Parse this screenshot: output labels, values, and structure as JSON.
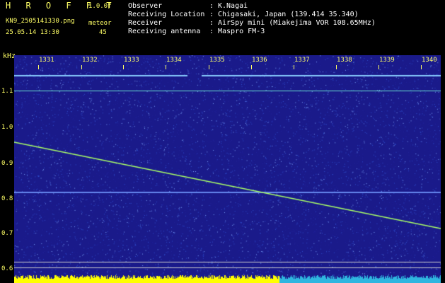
{
  "header": {
    "app_title": "H R O F F T",
    "version": "1.0.0f",
    "file_name": "KN9_2505141330.png",
    "meteor_label": "meteor",
    "date_time": "25.05.14 13:30",
    "meteor_count": "45"
  },
  "info": [
    {
      "key": "Observer",
      "value": "K.Nagai"
    },
    {
      "key": "Receiving Location",
      "value": "Chigasaki, Japan (139.414 35.340)"
    },
    {
      "key": "Receiver",
      "value": "AirSpy mini (Miakejima VOR 108.65MHz)"
    },
    {
      "key": "Receiving antenna",
      "value": "Maspro FM-3"
    }
  ],
  "spectrogram": {
    "unit": "kHz",
    "y_ticks": [
      "1.1",
      "1.0",
      "0.9",
      "0.8",
      "0.7",
      "0.6"
    ],
    "x_ticks": [
      "1331",
      "1332",
      "1333",
      "1334",
      "1335",
      "1336",
      "1337",
      "1338",
      "1339",
      "1340"
    ],
    "background_color": "#1a1a8a",
    "trace_color": "#aaff66",
    "signal_color": "#88ccff",
    "bar_color": "#ffff00"
  }
}
